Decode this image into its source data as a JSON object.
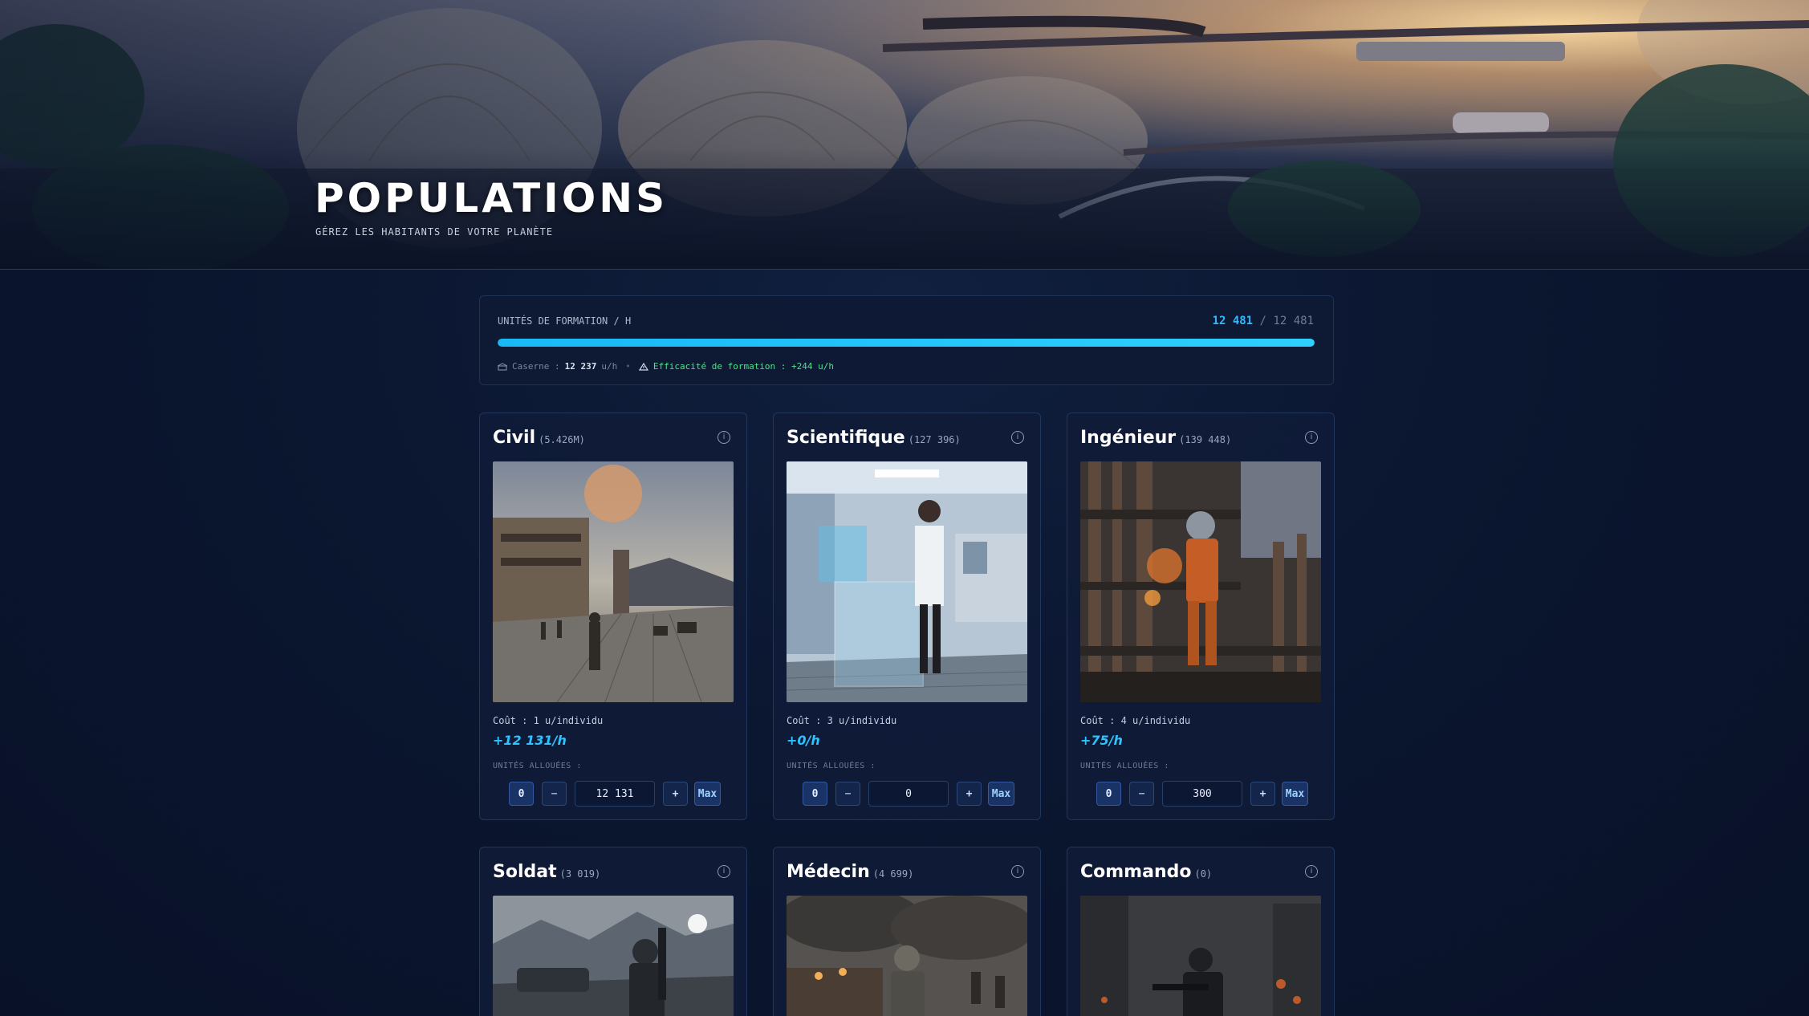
{
  "hero": {
    "title": "POPULATIONS",
    "subtitle": "GÉREZ LES HABITANTS DE VOTRE PLANÈTE"
  },
  "training": {
    "label": "UNITÉS DE FORMATION / H",
    "current": "12 481",
    "separator": "/",
    "max": "12 481",
    "fill_fraction": 1.0,
    "barracks_label": "Caserne :",
    "barracks_value": "12 237",
    "barracks_unit": "u/h",
    "efficiency_text": "Efficacité de formation : +244 u/h",
    "accent_color": "#2fc3ff",
    "efficiency_color": "#4ee08a"
  },
  "cards": [
    {
      "name": "Civil",
      "count": "(5.426M)",
      "cost": "Coût : 1 u/individu",
      "rate": "+12 131/h",
      "alloc_label": "UNITÉS ALLOUÉES :",
      "zero": "0",
      "minus": "−",
      "value": "12 131",
      "plus": "+",
      "max": "Max"
    },
    {
      "name": "Scientifique",
      "count": "(127 396)",
      "cost": "Coût : 3 u/individu",
      "rate": "+0/h",
      "alloc_label": "UNITÉS ALLOUÉES :",
      "zero": "0",
      "minus": "−",
      "value": "0",
      "plus": "+",
      "max": "Max"
    },
    {
      "name": "Ingénieur",
      "count": "(139 448)",
      "cost": "Coût : 4 u/individu",
      "rate": "+75/h",
      "alloc_label": "UNITÉS ALLOUÉES :",
      "zero": "0",
      "minus": "−",
      "value": "300",
      "plus": "+",
      "max": "Max"
    },
    {
      "name": "Soldat",
      "count": "(3 019)"
    },
    {
      "name": "Médecin",
      "count": "(4 699)"
    },
    {
      "name": "Commando",
      "count": "(0)"
    }
  ]
}
